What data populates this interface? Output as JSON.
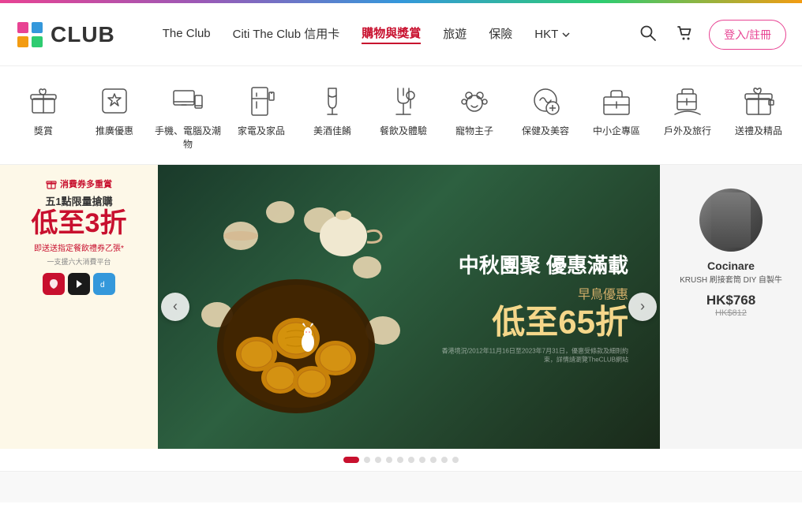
{
  "topbar": {},
  "header": {
    "logo_text": "CLUB",
    "nav_items": [
      {
        "label": "The Club",
        "active": false
      },
      {
        "label": "Citi The Club 信用卡",
        "active": false
      },
      {
        "label": "購物與獎賞",
        "active": true
      },
      {
        "label": "旅遊",
        "active": false
      },
      {
        "label": "保險",
        "active": false
      },
      {
        "label": "HKT",
        "active": false,
        "dropdown": true
      }
    ],
    "search_label": "search",
    "cart_label": "cart",
    "login_label": "登入/註冊"
  },
  "categories": [
    {
      "label": "獎賞",
      "icon": "gift"
    },
    {
      "label": "推廣優惠",
      "icon": "star-tag"
    },
    {
      "label": "手機、電腦及潮物",
      "icon": "phone-monitor"
    },
    {
      "label": "家電及家品",
      "icon": "fridge-camera"
    },
    {
      "label": "美酒佳餚",
      "icon": "wine"
    },
    {
      "label": "餐飲及體驗",
      "icon": "dining"
    },
    {
      "label": "寵物主子",
      "icon": "pet"
    },
    {
      "label": "保健及美容",
      "icon": "health"
    },
    {
      "label": "中小企專區",
      "icon": "briefcase"
    },
    {
      "label": "戶外及旅行",
      "icon": "travel"
    },
    {
      "label": "送禮及精品",
      "icon": "gift-special"
    }
  ],
  "banner_left": {
    "title": "消費券多重賞",
    "big_text": "五1點限量搶購",
    "promo": "低至3折",
    "asterisk": "*",
    "desc": "即送送指定餐飲禮券乙張*",
    "note": "一支援六大消費平台"
  },
  "banner_main": {
    "title": "中秋團聚 優惠滿載",
    "subtitle": "早鳥優惠",
    "promo": "低至65折",
    "footnote": "香港境況/2012年11月16日至2023年7月31日，優惠受條款及細則約束，詳情請瀏覽TheCLUB網站"
  },
  "banner_right": {
    "brand": "Cocinare",
    "product_name": "KRUSH 刷接套筒 DIY 自製牛",
    "price": "HK$768",
    "original_price": "HK$812"
  },
  "dots": {
    "total": 10,
    "active": 0
  },
  "arrows": {
    "left": "‹",
    "right": "›"
  }
}
